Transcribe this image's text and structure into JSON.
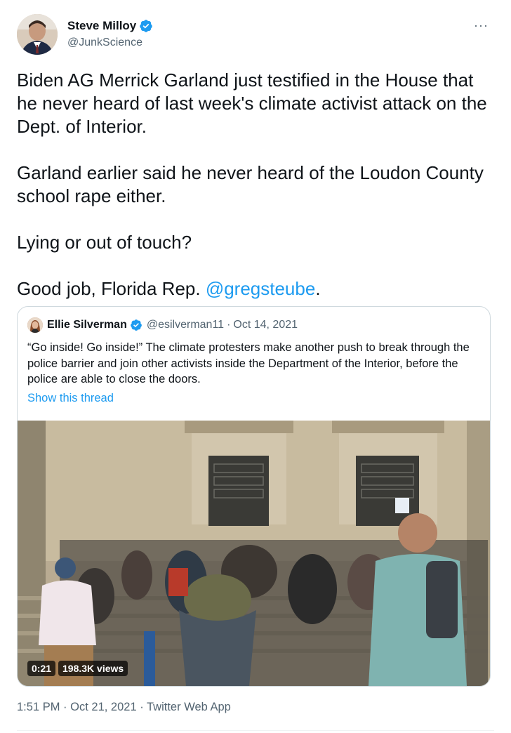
{
  "author": {
    "name": "Steve Milloy",
    "handle": "@JunkScience"
  },
  "more_label": "···",
  "tweet": {
    "line1": "Biden AG Merrick Garland just testified in the House that he never heard of last week's climate activist attack on the Dept. of Interior.",
    "line2": "Garland earlier said he never heard of the Loudon County school rape either.",
    "line3": "Lying or out of touch?",
    "line4_prefix": "Good job, Florida Rep. ",
    "mention": "@gregsteube",
    "line4_suffix": "."
  },
  "quoted": {
    "name": "Ellie Silverman",
    "handle": "@esilverman11",
    "separator": "·",
    "date": "Oct 14, 2021",
    "text": "“Go inside! Go inside!” The climate protesters make another push to break through the police barrier and join other activists inside the Department of the Interior, before the police are able to close the doors.",
    "show_thread": "Show this thread",
    "video": {
      "duration": "0:21",
      "views": "198.3K views"
    }
  },
  "footer": {
    "time": "1:51 PM",
    "sep1": "·",
    "date": "Oct 21, 2021",
    "sep2": "·",
    "app": "Twitter Web App"
  },
  "colors": {
    "link": "#1d9bf0",
    "verified": "#1d9bf0",
    "text": "#0f1419",
    "muted": "#536471",
    "border": "#cfd9de"
  },
  "icons": [
    "verified-badge-icon",
    "more-options-icon"
  ]
}
